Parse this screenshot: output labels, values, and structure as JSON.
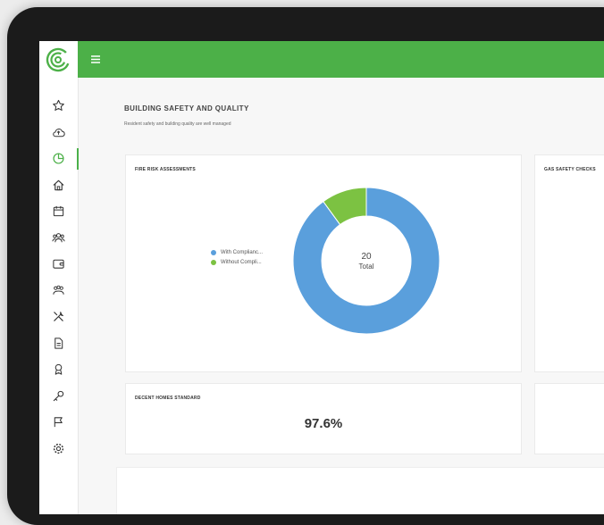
{
  "section": {
    "title": "BUILDING SAFETY AND QUALITY",
    "subtitle": "Resident safety and building quality are well managed"
  },
  "fire_card": {
    "title": "FIRE RISK ASSESSMENTS",
    "legend": [
      {
        "label": "With Complianc...",
        "color": "#5a9fdc"
      },
      {
        "label": "Without Compli...",
        "color": "#7cc242"
      }
    ],
    "total_value": "20",
    "total_label": "Total"
  },
  "gas_card": {
    "title": "GAS SAFETY CHECKS"
  },
  "decent_card": {
    "title": "DECENT HOMES STANDARD",
    "value": "97.6%"
  },
  "chart_data": {
    "type": "pie",
    "categories": [
      "With Complianc...",
      "Without Compli..."
    ],
    "values": [
      18,
      2
    ],
    "colors": [
      "#5a9fdc",
      "#7cc242"
    ]
  },
  "sidebar": {
    "icons": [
      "star-icon",
      "cloud-icon",
      "chart-icon",
      "home-icon",
      "calendar-icon",
      "users-icon",
      "wallet-icon",
      "community-icon",
      "tools-icon",
      "document-icon",
      "certificate-icon",
      "key-icon",
      "flag-icon",
      "settings-icon"
    ],
    "active_index": 2
  },
  "colors": {
    "brand_green": "#4cb048"
  }
}
